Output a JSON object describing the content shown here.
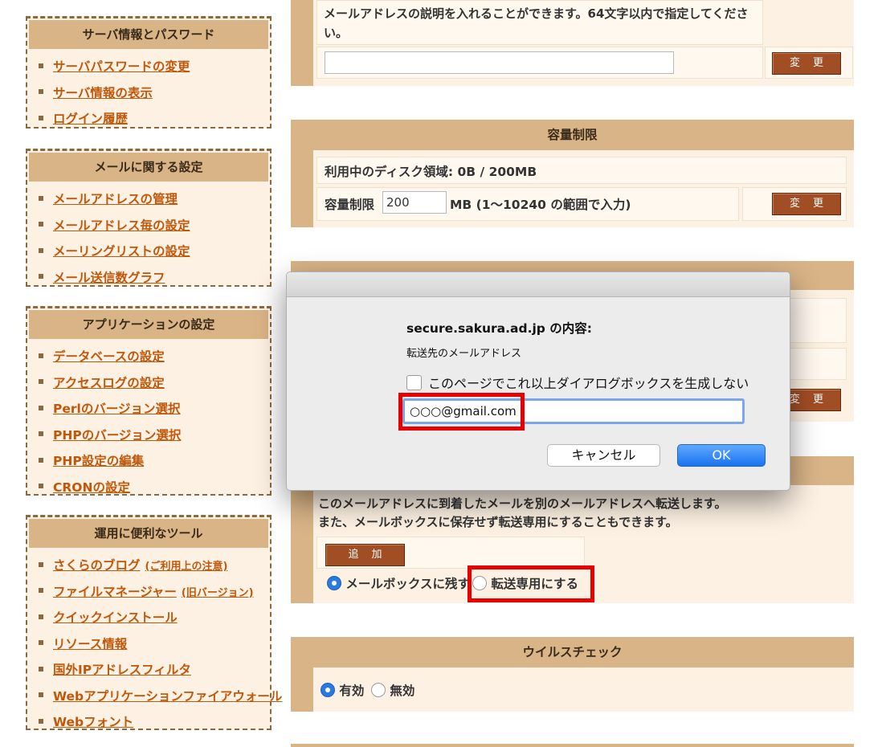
{
  "sidebar": {
    "groups": [
      {
        "title": "サーバ情報とパスワード",
        "items": [
          {
            "label": "サーバパスワードの変更"
          },
          {
            "label": "サーバ情報の表示"
          },
          {
            "label": "ログイン履歴"
          }
        ]
      },
      {
        "title": "メールに関する設定",
        "items": [
          {
            "label": "メールアドレスの管理"
          },
          {
            "label": "メールアドレス毎の設定"
          },
          {
            "label": "メーリングリストの設定"
          },
          {
            "label": "メール送信数グラフ"
          }
        ]
      },
      {
        "title": "アプリケーションの設定",
        "items": [
          {
            "label": "データベースの設定"
          },
          {
            "label": "アクセスログの設定"
          },
          {
            "label": "Perlのバージョン選択"
          },
          {
            "label": "PHPのバージョン選択"
          },
          {
            "label": "PHP設定の編集"
          },
          {
            "label": "CRONの設定"
          }
        ]
      },
      {
        "title": "運用に便利なツール",
        "items": [
          {
            "label": "さくらのブログ",
            "note": "(ご利用上の注意)"
          },
          {
            "label": "ファイルマネージャー",
            "note": "(旧バージョン)"
          },
          {
            "label": "クイックインストール"
          },
          {
            "label": "リソース情報"
          },
          {
            "label": "国外IPアドレスフィルタ"
          },
          {
            "label": "Webアプリケーションファイアウォール"
          },
          {
            "label": "Webフォント"
          }
        ]
      }
    ]
  },
  "description_panel": {
    "text_line1": "メールアドレスの説明を入れることができます。64文字以内で指定してくださ",
    "text_line2": "い。",
    "input_value": "",
    "button": "変更"
  },
  "quota_panel": {
    "title": "容量制限",
    "disk_usage": "利用中のディスク領域: 0B / 200MB",
    "limit_label": "容量制限",
    "limit_value": "200",
    "limit_hint": "MB (1〜10240 の範囲で入力)",
    "button": "変更"
  },
  "forward_panel": {
    "button": "変更",
    "desc_line1": "このメールアドレスに到着したメールを別のメールアドレスへ転送します。",
    "desc_line2": "また、メールボックスに保存せず転送専用にすることもできます。",
    "add_button": "追加",
    "radio_keep": "メールボックスに残す",
    "radio_forward_only": "転送専用にする"
  },
  "virus_panel": {
    "title": "ウイルスチェック",
    "radio_on": "有効",
    "radio_off": "無効"
  },
  "dialog": {
    "title": "secure.sakura.ad.jp の内容:",
    "message": "転送先のメールアドレス",
    "checkbox_label": "このページでこれ以上ダイアログボックスを生成しない",
    "input_value": "○○○@gmail.com",
    "cancel": "キャンセル",
    "ok": "OK"
  },
  "colors": {
    "accent_brown": "#d9b487",
    "panel_bg": "#fdf1e3",
    "link": "#c0580b",
    "button": "#a24e25",
    "highlight_red": "#e80000",
    "ok_blue": "#1a73f0"
  }
}
